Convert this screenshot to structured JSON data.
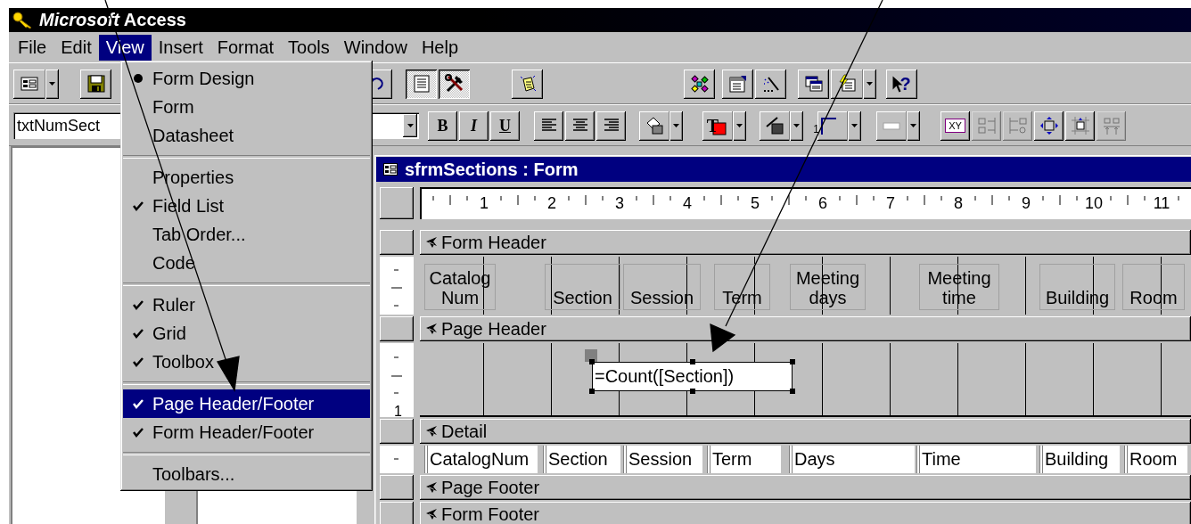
{
  "window": {
    "title": "*Microsoft* Access"
  },
  "menu_bar": [
    {
      "label": "File",
      "selected": false
    },
    {
      "label": "Edit",
      "selected": false
    },
    {
      "label": "View",
      "selected": true
    },
    {
      "label": "Insert",
      "selected": false
    },
    {
      "label": "Format",
      "selected": false
    },
    {
      "label": "Tools",
      "selected": false
    },
    {
      "label": "Window",
      "selected": false
    },
    {
      "label": "Help",
      "selected": false
    }
  ],
  "view_menu": {
    "groups": [
      [
        {
          "label": "Form Design",
          "kind": "radio",
          "checked": true,
          "selected": false
        },
        {
          "label": "Form",
          "kind": "radio",
          "checked": false,
          "selected": false
        },
        {
          "label": "Datasheet",
          "kind": "radio",
          "checked": false,
          "selected": false
        }
      ],
      [
        {
          "label": "Properties",
          "kind": "check",
          "checked": false,
          "selected": false
        },
        {
          "label": "Field List",
          "kind": "check",
          "checked": true,
          "selected": false
        },
        {
          "label": "Tab Order...",
          "kind": "check",
          "checked": false,
          "selected": false
        },
        {
          "label": "Code",
          "kind": "check",
          "checked": false,
          "selected": false
        }
      ],
      [
        {
          "label": "Ruler",
          "kind": "check",
          "checked": true,
          "selected": false
        },
        {
          "label": "Grid",
          "kind": "check",
          "checked": true,
          "selected": false
        },
        {
          "label": "Toolbox",
          "kind": "check",
          "checked": true,
          "selected": false
        }
      ],
      [
        {
          "label": "Page Header/Footer",
          "kind": "check",
          "checked": true,
          "selected": true
        },
        {
          "label": "Form Header/Footer",
          "kind": "check",
          "checked": true,
          "selected": false
        }
      ],
      [
        {
          "label": "Toolbars...",
          "kind": "check",
          "checked": false,
          "selected": false
        }
      ]
    ]
  },
  "toolbar_1": {
    "groups": [
      [
        {
          "kind": "form-view",
          "pressed": false,
          "dropdown": true
        }
      ],
      [
        {
          "kind": "save",
          "pressed": false,
          "dropdown": false
        }
      ],
      [
        {
          "kind": "undo",
          "pressed": false,
          "dropdown": false
        }
      ],
      [
        {
          "kind": "field-list",
          "pressed": true,
          "dropdown": false
        },
        {
          "kind": "toolbox",
          "pressed": true,
          "dropdown": false
        }
      ],
      [
        {
          "kind": "autoformat",
          "pressed": false,
          "dropdown": false
        }
      ],
      [
        {
          "kind": "code",
          "pressed": false,
          "dropdown": false
        }
      ],
      [
        {
          "kind": "properties",
          "pressed": false,
          "dropdown": false
        },
        {
          "kind": "build",
          "pressed": false,
          "dropdown": false
        }
      ],
      [
        {
          "kind": "database-window",
          "pressed": false,
          "dropdown": false
        },
        {
          "kind": "new-object",
          "pressed": false,
          "dropdown": true
        }
      ],
      [
        {
          "kind": "help",
          "label": "?",
          "pressed": false,
          "dropdown": false
        }
      ]
    ]
  },
  "toolbar_2": {
    "groups": [
      [
        {
          "kind": "combo",
          "value": "txtNumSect"
        }
      ],
      [
        {
          "kind": "combo",
          "dropdown": true
        }
      ],
      [
        {
          "kind": "bold",
          "label": "B",
          "dropdown": false,
          "disabled": false
        },
        {
          "kind": "italic",
          "label": "I",
          "dropdown": false,
          "disabled": false
        },
        {
          "kind": "underline",
          "label": "U",
          "dropdown": false,
          "disabled": false
        }
      ],
      [
        {
          "kind": "align-left",
          "dropdown": false,
          "disabled": false
        },
        {
          "kind": "align-center",
          "dropdown": false,
          "disabled": false
        },
        {
          "kind": "align-right",
          "dropdown": false,
          "disabled": false
        }
      ],
      [
        {
          "kind": "fill-color",
          "dropdown": true,
          "disabled": false
        }
      ],
      [
        {
          "kind": "font-color",
          "label": "T",
          "dropdown": true,
          "disabled": false
        }
      ],
      [
        {
          "kind": "line-color",
          "dropdown": true,
          "disabled": false
        }
      ],
      [
        {
          "kind": "border-width",
          "label": "1",
          "dropdown": true,
          "disabled": false
        }
      ],
      [
        {
          "kind": "special-effect",
          "dropdown": true,
          "disabled": false
        }
      ],
      [
        {
          "kind": "field-box",
          "label": "XY",
          "dropdown": false,
          "disabled": false
        },
        {
          "kind": "align-grid",
          "dropdown": false,
          "disabled": true
        },
        {
          "kind": "align-spacing",
          "dropdown": false,
          "disabled": true
        },
        {
          "kind": "size-to-fit",
          "dropdown": false,
          "disabled": false
        },
        {
          "kind": "size-to-grid",
          "dropdown": false,
          "disabled": false
        },
        {
          "kind": "stack",
          "dropdown": false,
          "disabled": true
        }
      ]
    ]
  },
  "form_window": {
    "title": "sfrmSections : Form",
    "ruler": [
      "1",
      "2",
      "3",
      "4",
      "5",
      "6",
      "7",
      "8",
      "9",
      "10",
      "11"
    ],
    "sections": [
      {
        "kind": "form-header",
        "title": "Form Header",
        "labels": [
          {
            "lines": [
              "Catalog",
              "Num"
            ]
          },
          {
            "lines": [
              "Section"
            ]
          },
          {
            "lines": [
              "Session"
            ]
          },
          {
            "lines": [
              "Term"
            ]
          },
          {
            "lines": [
              "Meeting",
              "days"
            ]
          },
          {
            "lines": [
              "Meeting",
              "time"
            ]
          },
          {
            "lines": [
              "Building"
            ]
          },
          {
            "lines": [
              "Room"
            ]
          }
        ]
      },
      {
        "kind": "page-header",
        "title": "Page Header",
        "ruler_label": "1",
        "text_boxes": [
          {
            "value": "=Count([Section])",
            "selected": true
          }
        ]
      },
      {
        "kind": "detail",
        "title": "Detail",
        "text_boxes": [
          {
            "value": "CatalogNum",
            "selected": false
          },
          {
            "value": "Section",
            "selected": false
          },
          {
            "value": "Session",
            "selected": false
          },
          {
            "value": "Term",
            "selected": false
          },
          {
            "value": "Days",
            "selected": false
          },
          {
            "value": "Time",
            "selected": false
          },
          {
            "value": "Building",
            "selected": false
          },
          {
            "value": "Room",
            "selected": false
          }
        ]
      },
      {
        "kind": "page-footer",
        "title": "Page Footer"
      },
      {
        "kind": "form-footer",
        "title": "Form Footer"
      }
    ]
  }
}
